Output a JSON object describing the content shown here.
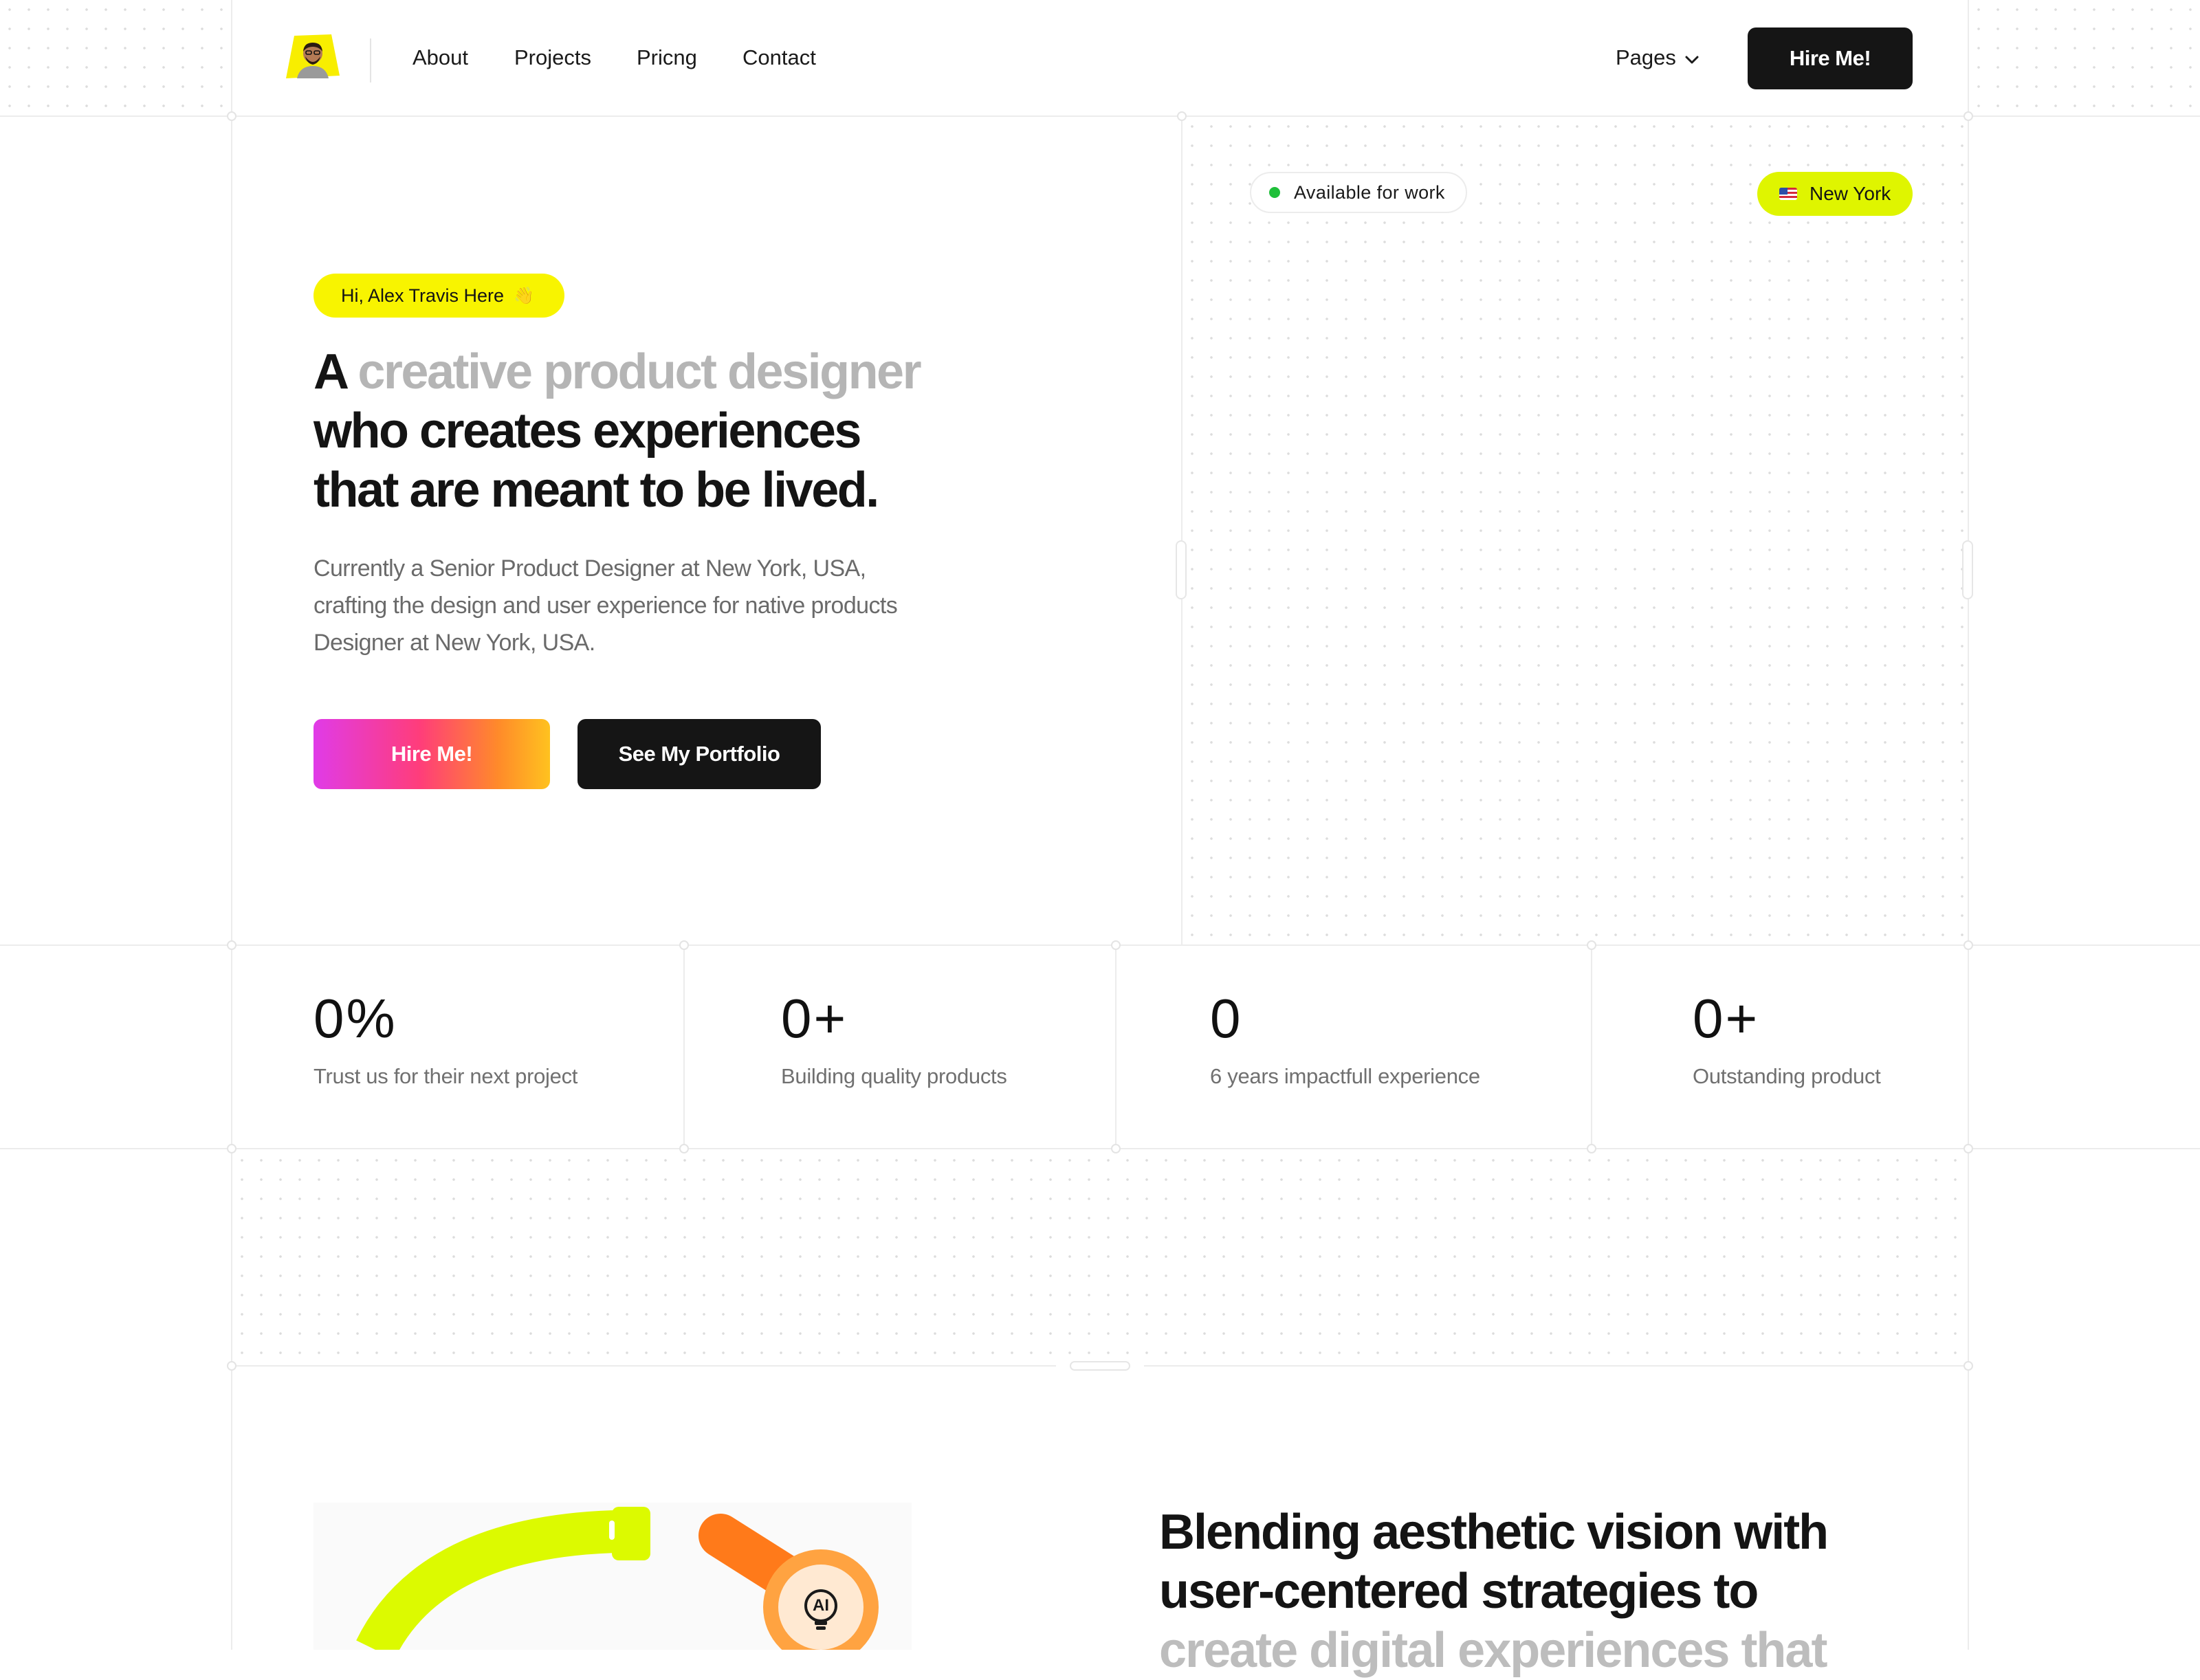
{
  "header": {
    "nav": [
      "About",
      "Projects",
      "Pricng",
      "Contact"
    ],
    "pages_label": "Pages",
    "hire_label": "Hire Me!"
  },
  "hero": {
    "greeting": "Hi, Alex Travis Here",
    "greeting_emoji": "👋",
    "headline_lead": "A",
    "headline_highlight": "creative product designer",
    "headline_line2": "who creates experiences",
    "headline_line3": "that are meant to be lived.",
    "description_lines": [
      "Currently a Senior Product Designer at New York, USA,",
      "crafting the design and user experience for native products",
      "Designer at New York, USA."
    ],
    "primary_button": "Hire Me!",
    "secondary_button": "See My Portfolio",
    "availability": "Available for work",
    "location": "New York"
  },
  "stats": [
    {
      "value": "0%",
      "label": "Trust us for their next project"
    },
    {
      "value": "0+",
      "label": "Building quality products"
    },
    {
      "value": "0",
      "label": "6 years impactfull experience"
    },
    {
      "value": "0+",
      "label": "Outstanding product"
    }
  ],
  "about": {
    "heading_line1": "Blending aesthetic vision with",
    "heading_line2": "user-centered strategies to",
    "heading_line3": "create digital experiences that",
    "badge_text": "AI"
  },
  "colors": {
    "accent_yellow": "#f8f400",
    "accent_lime": "#dff500",
    "dark": "#151515",
    "status_green": "#1fbf3a"
  }
}
